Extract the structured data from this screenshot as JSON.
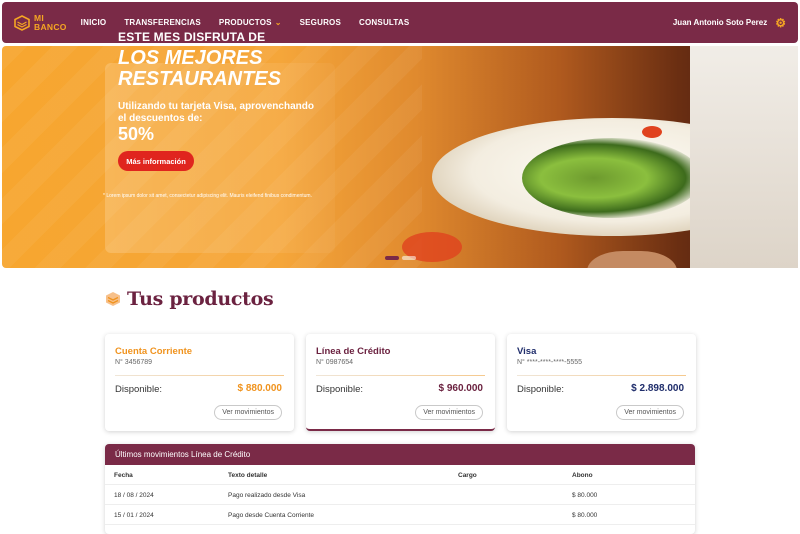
{
  "nav": {
    "logo_line1": "MI",
    "logo_line2": "BANCO",
    "items": [
      {
        "label": "INICIO"
      },
      {
        "label": "TRANSFERENCIAS"
      },
      {
        "label": "PRODUCTOS"
      },
      {
        "label": "SEGUROS"
      },
      {
        "label": "CONSULTAS"
      }
    ],
    "user_name": "Juan Antonio Soto Perez",
    "settings_icon": "gear-icon"
  },
  "hero": {
    "eyebrow": "ESTE MES DISFRUTA DE",
    "title_line1": "LOS MEJORES",
    "title_line2": "RESTAURANTES",
    "subtitle": "Utilizando tu tarjeta Visa, aprovenchando el descuentos de:",
    "discount": "50%",
    "button_label": "Más información",
    "disclaimer": "* Lorem ipsum dolor sit amet, consectetur adipiscing elit. Mauris eleifend finibus condimentum.",
    "slides": 2,
    "active_slide": 1
  },
  "products": {
    "title": "Tus productos",
    "cards": [
      {
        "name": "Cuenta Corriente",
        "number": "N° 3456789",
        "available_label": "Disponible:",
        "amount": "$ 880.000",
        "color": "#f0931e",
        "button": "Ver movimientos"
      },
      {
        "name": "Línea de Crédito",
        "number": "N° 0987654",
        "available_label": "Disponible:",
        "amount": "$ 960.000",
        "color": "#6b2240",
        "button": "Ver movimientos"
      },
      {
        "name": "Visa",
        "number": "N° ****-****-****-5555",
        "available_label": "Disponible:",
        "amount": "$ 2.898.000",
        "color": "#1f2d6b",
        "button": "Ver movimientos"
      }
    ]
  },
  "movements": {
    "title": "Últimos movimientos Línea de Crédito",
    "columns": [
      "Fecha",
      "Texto detalle",
      "Cargo",
      "Abono"
    ],
    "rows": [
      [
        "18 / 08 / 2024",
        "Pago realizado desde Visa",
        "",
        "$ 80.000"
      ],
      [
        "15 / 01 / 2024",
        "Pago desde Cuenta Corriente",
        "",
        "$ 80.000"
      ]
    ]
  },
  "colors": {
    "brand": "#7a2a47",
    "accent": "#f5a623",
    "cta": "#e0251e"
  }
}
